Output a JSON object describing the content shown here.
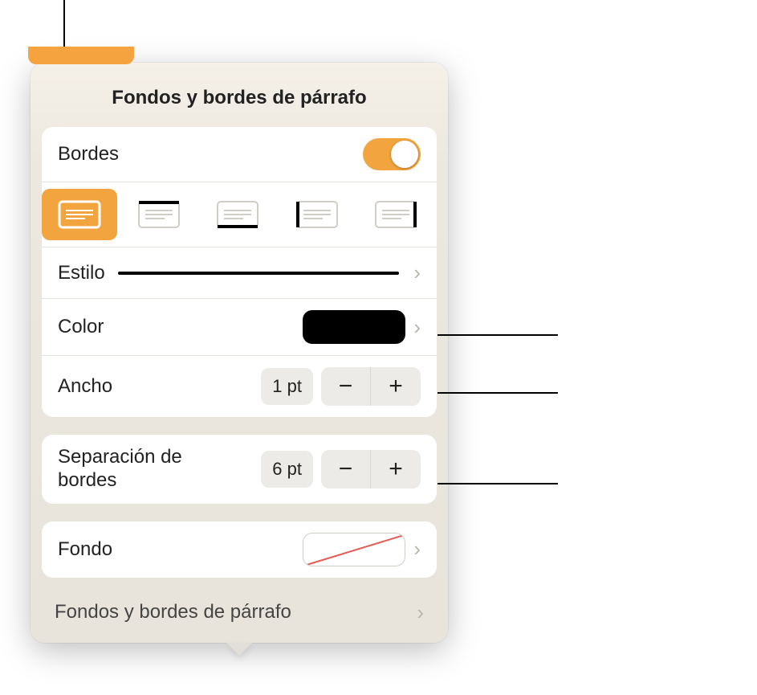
{
  "title": "Fondos y bordes de párrafo",
  "borders": {
    "label": "Bordes",
    "enabled": true,
    "positions": [
      "all",
      "top",
      "bottom",
      "left",
      "right"
    ],
    "selected": "all",
    "style": {
      "label": "Estilo"
    },
    "color": {
      "label": "Color",
      "value": "#000000"
    },
    "width": {
      "label": "Ancho",
      "value": "1 pt"
    },
    "offset": {
      "label": "Separación de\nbordes",
      "value": "6 pt"
    }
  },
  "background": {
    "label": "Fondo",
    "value": "none"
  },
  "bottom_link": "Fondos y bordes de párrafo",
  "glyphs": {
    "minus": "−",
    "plus": "+",
    "chevron": "›"
  }
}
